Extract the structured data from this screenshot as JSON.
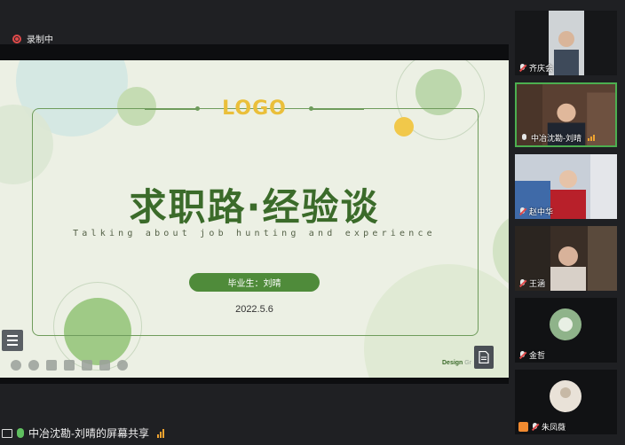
{
  "recording": {
    "label": "录制中"
  },
  "slide": {
    "logo": "LOGO",
    "title": "求职路·经验谈",
    "subtitle": "Talking about job hunting and experience",
    "graduate_label": "毕业生：刘晴",
    "date": "2022.5.6",
    "footer_design": "Design",
    "footer_rest": "Gr"
  },
  "participants": [
    {
      "name": "齐庆会",
      "muted": true,
      "speaking": false
    },
    {
      "name": "中冶沈勘-刘晴",
      "muted": false,
      "speaking": true
    },
    {
      "name": "赵中华",
      "muted": true,
      "speaking": false
    },
    {
      "name": "王涵",
      "muted": true,
      "speaking": false
    },
    {
      "name": "金哲",
      "muted": true,
      "speaking": false
    },
    {
      "name": "朱凤薇",
      "muted": true,
      "speaking": false
    }
  ],
  "bottom_bar": {
    "share_label": "中冶沈勘-刘晴的屏幕共享"
  },
  "colors": {
    "accent_green": "#4f8b3a",
    "logo_yellow": "#eabf3a",
    "speaking_border": "#4caf50"
  }
}
